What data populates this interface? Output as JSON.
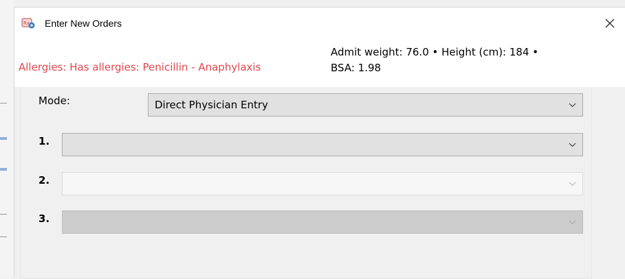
{
  "window": {
    "title": "Enter New Orders",
    "close_symbol": "✕"
  },
  "patient": {
    "allergies": "Allergies: Has allergies: Penicillin - Anaphylaxis",
    "vitals_line1": "Admit weight: 76.0  •  Height (cm): 184  •",
    "vitals_line2": "BSA: 1.98"
  },
  "form": {
    "mode_label": "Mode:",
    "mode_value": "Direct Physician Entry",
    "rows": [
      {
        "label": "1.",
        "value": ""
      },
      {
        "label": "2.",
        "value": ""
      },
      {
        "label": "3.",
        "value": ""
      }
    ]
  },
  "colors": {
    "allergy_text": "#e0474c",
    "combo_bg": "#e1e1e1",
    "combo_disabled_bg": "#cccccc"
  },
  "icons": {
    "app": "orders-app-icon",
    "close": "close-icon",
    "dropdown": "chevron-down-icon"
  }
}
